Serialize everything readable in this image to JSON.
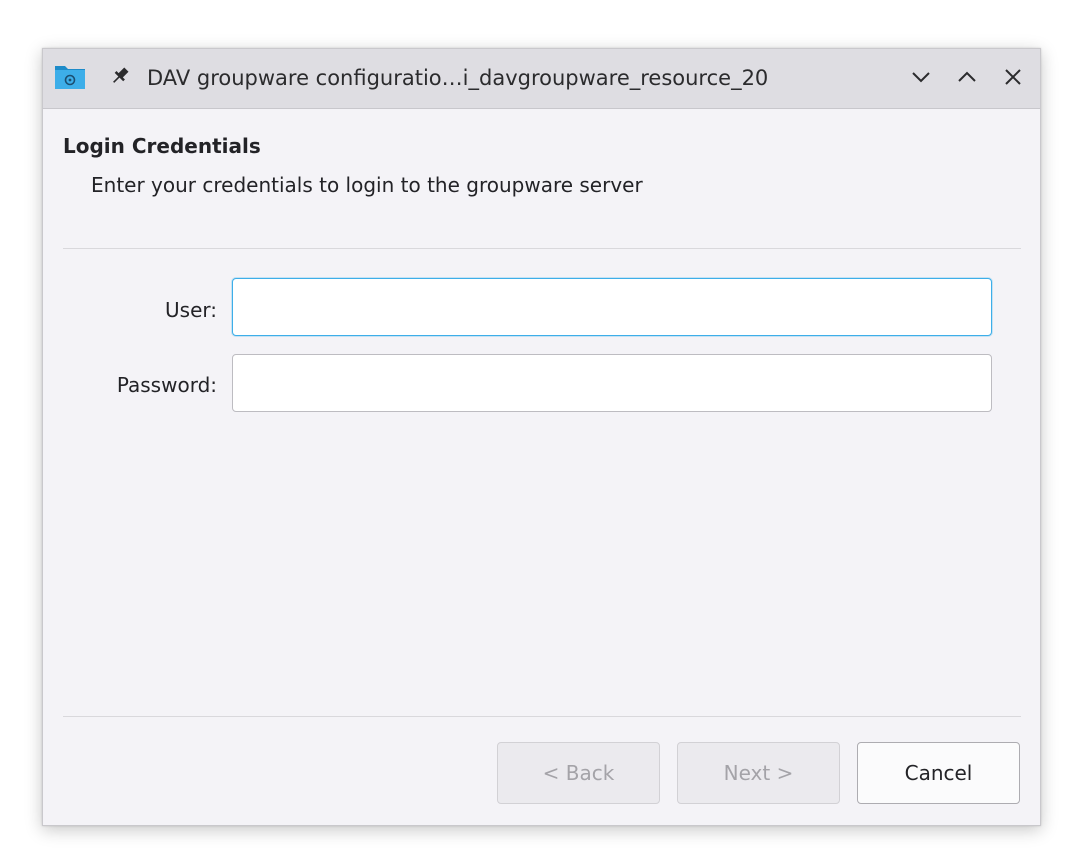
{
  "window": {
    "title": "DAV groupware configuratio…i_davgroupware_resource_20",
    "controls": {
      "minimize_icon": "chevron-down-icon",
      "maximize_icon": "chevron-up-icon",
      "close_icon": "close-icon"
    }
  },
  "page": {
    "title": "Login Credentials",
    "subtitle": "Enter your credentials to login to the groupware server"
  },
  "form": {
    "user_label": "User:",
    "user_value": "",
    "password_label": "Password:",
    "password_value": ""
  },
  "buttons": {
    "back_label": "< Back",
    "next_label": "Next >",
    "cancel_label": "Cancel"
  },
  "colors": {
    "accent": "#3daee9",
    "window_bg": "#f4f3f7",
    "titlebar_bg": "#dedde2"
  }
}
